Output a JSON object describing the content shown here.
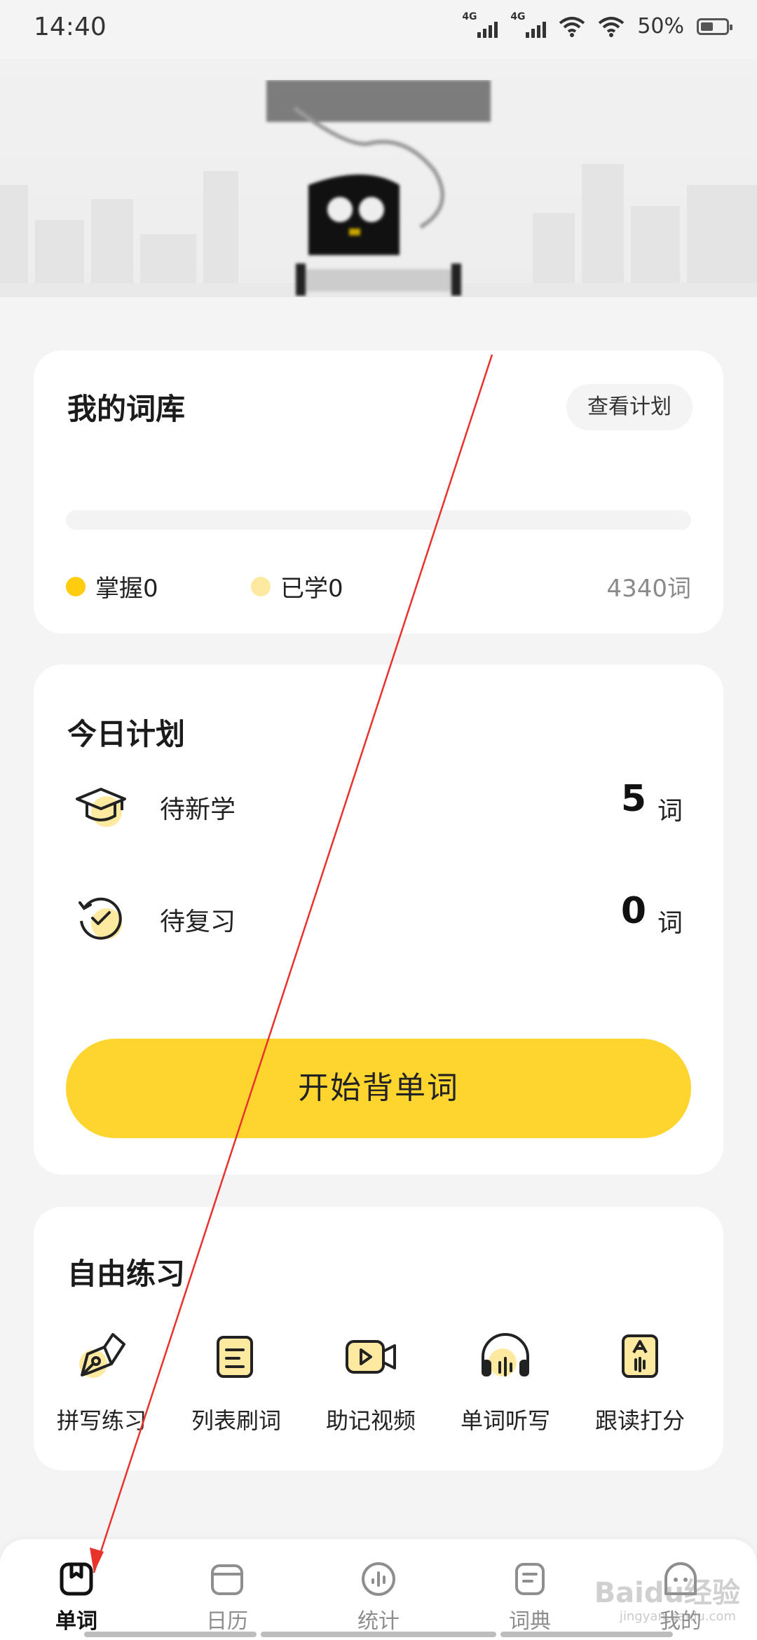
{
  "status_bar": {
    "time": "14:40",
    "network_1": "4G",
    "network_2": "4G",
    "battery": "50%",
    "battery_level": 0.5
  },
  "colors": {
    "accent": "#FED52F",
    "mastered_dot": "#FFCC0F",
    "learned_dot": "#FDE9A0",
    "background": "#F4F4F4",
    "annotation_arrow": "#E8322B"
  },
  "hero": {
    "logo": "pixelated-app-logo"
  },
  "library": {
    "title": "我的词库",
    "plan_button": "查看计划",
    "progress_mastered": 0,
    "progress_learned": 0,
    "mastered_label": "掌握0",
    "learned_label": "已学0",
    "total": "4340词"
  },
  "today_plan": {
    "title": "今日计划",
    "rows": [
      {
        "icon": "graduation-cap-icon",
        "label": "待新学",
        "count": "5",
        "unit": "词"
      },
      {
        "icon": "review-clock-icon",
        "label": "待复习",
        "count": "0",
        "unit": "词"
      }
    ],
    "start_button": "开始背单词"
  },
  "free_practice": {
    "title": "自由练习",
    "tools": [
      {
        "icon": "pen-nib-icon",
        "label": "拼写练习"
      },
      {
        "icon": "list-document-icon",
        "label": "列表刷词"
      },
      {
        "icon": "video-camera-icon",
        "label": "助记视频"
      },
      {
        "icon": "headphones-icon",
        "label": "单词听写"
      },
      {
        "icon": "read-along-icon",
        "label": "跟读打分"
      }
    ]
  },
  "tab_bar": {
    "tabs": [
      {
        "icon": "book-icon",
        "label": "单词",
        "active": true
      },
      {
        "icon": "calendar-icon",
        "label": "日历",
        "active": false
      },
      {
        "icon": "stats-icon",
        "label": "统计",
        "active": false
      },
      {
        "icon": "dictionary-icon",
        "label": "词典",
        "active": false
      },
      {
        "icon": "profile-icon",
        "label": "我的",
        "active": false
      }
    ]
  },
  "watermark": {
    "brand": "Baidu经验",
    "url": "jingyan.baidu.com"
  }
}
